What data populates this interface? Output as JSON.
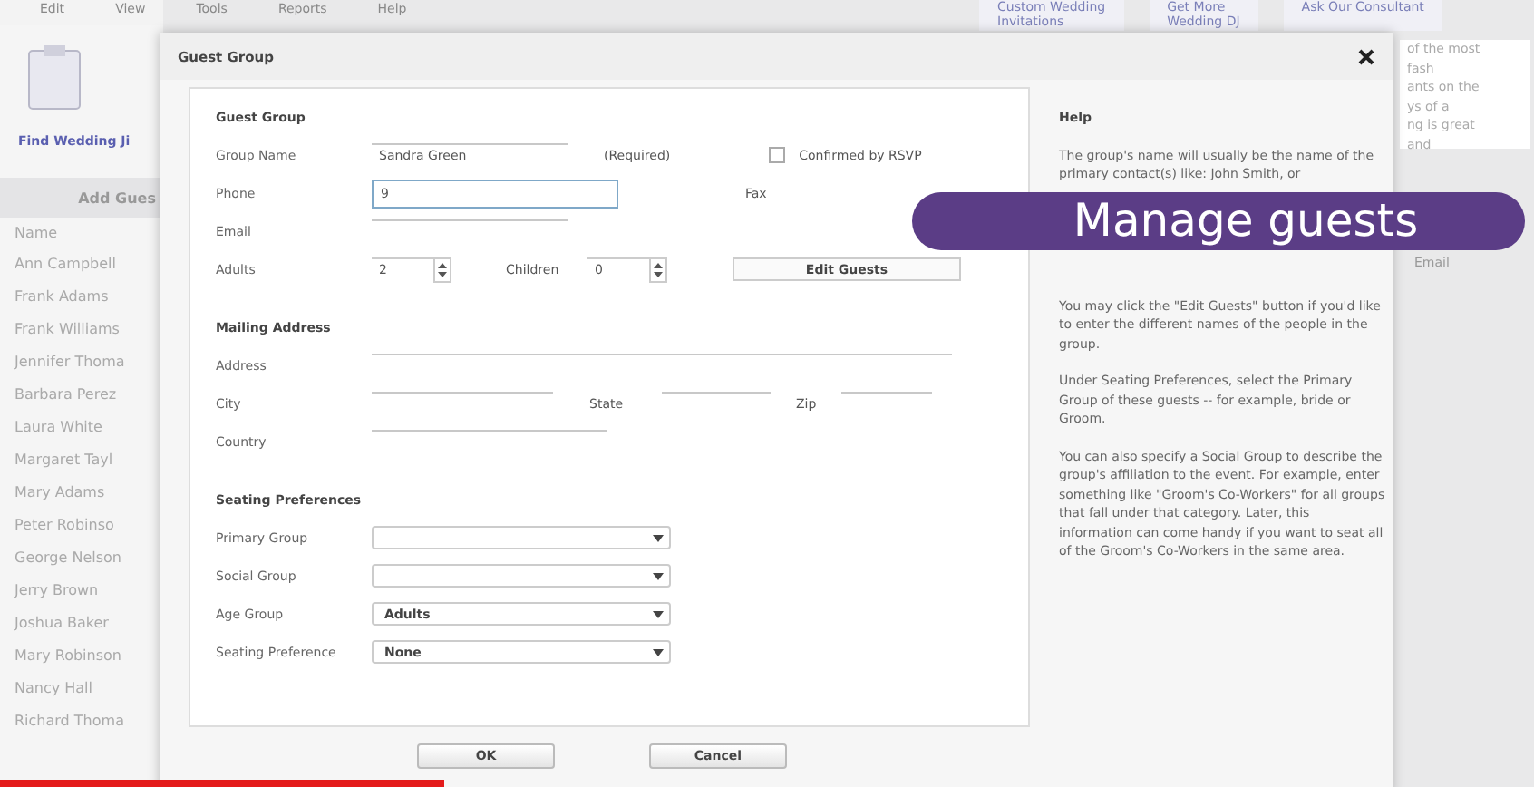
{
  "app": {
    "menu": [
      "Edit",
      "View",
      "Tools",
      "Reports",
      "Help"
    ],
    "find_link": "Find Wedding Ji",
    "add_button": "Add Gues",
    "list_header": "Name",
    "guests": [
      "Ann Campbell",
      "Frank Adams",
      "Frank Williams",
      "Jennifer Thoma",
      "Barbara Perez",
      "Laura White",
      "Margaret Tayl",
      "Mary Adams",
      "Peter Robinso",
      "George Nelson",
      "Jerry Brown",
      "Joshua Baker",
      "Mary Robinson",
      "Nancy Hall",
      "Richard Thoma"
    ],
    "tabs": [
      {
        "lines": [
          "Custom Wedding",
          "Invitations"
        ]
      },
      {
        "lines": [
          "Get More",
          "Wedding DJ"
        ]
      },
      {
        "lines": [
          "Ask Our Consultant"
        ]
      }
    ],
    "side_text": [
      "of the most",
      "fash",
      "ants on the",
      "ys of a",
      "ng is great",
      "and"
    ],
    "side_column": "Email"
  },
  "dialog": {
    "title": "Guest Group",
    "section_title": "Guest Group",
    "group_name": {
      "label": "Group Name",
      "value": "Sandra Green",
      "note": "(Required)"
    },
    "confirmed": {
      "label": "Confirmed by RSVP",
      "checked": false
    },
    "phone": {
      "label": "Phone",
      "value": "9",
      "focused": true
    },
    "fax": {
      "label": "Fax"
    },
    "email": {
      "label": "Email"
    },
    "adults": {
      "label": "Adults",
      "value": "2"
    },
    "children": {
      "label": "Children",
      "value": "0"
    },
    "edit_guests": "Edit Guests",
    "mailing": {
      "title": "Mailing Address",
      "address": "Address",
      "city": "City",
      "state": "State",
      "zip": "Zip",
      "country": "Country"
    },
    "seating": {
      "title": "Seating Preferences",
      "dropdowns": [
        {
          "label": "Primary Group"
        },
        {
          "label": "Social Group"
        },
        {
          "label": "Age Group",
          "value": "Adults"
        },
        {
          "label": "Seating Preference",
          "value": "None"
        }
      ]
    },
    "buttons": [
      "OK",
      "Cancel"
    ],
    "help": {
      "title": "Help",
      "paragraphs": [
        "The group's name will usually be the name of the primary contact(s) like: John Smith, or",
        "You may click the \"Edit Guests\" button if you'd like to enter the different names of the people in the group.",
        "Under Seating Preferences, select the Primary Group of these guests -- for example, bride or Groom.",
        "You can also specify a Social Group to describe the group's affiliation to the event. For example, enter something like \"Groom's Co-Workers\" for all groups that fall under that category.  Later, this information can come handy if you want to seat all of the Groom's Co-Workers in the same area."
      ]
    }
  },
  "caption": "Manage guests",
  "video_progress": {
    "level": 0.29
  }
}
